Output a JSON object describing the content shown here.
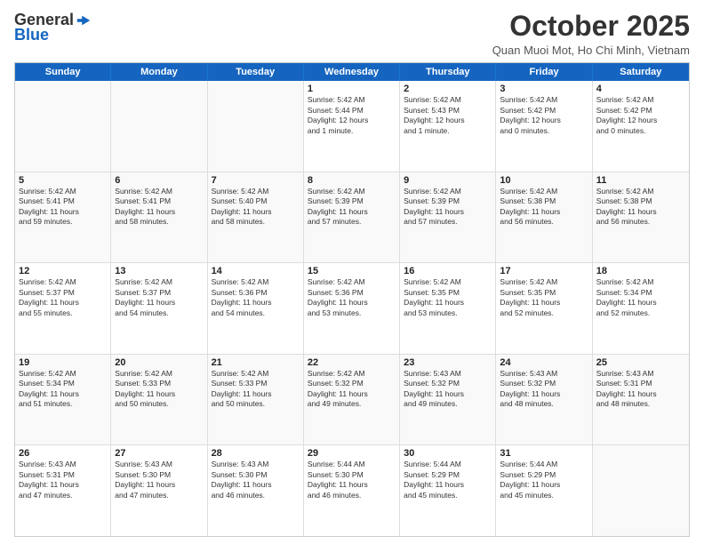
{
  "header": {
    "logo_general": "General",
    "logo_blue": "Blue",
    "title": "October 2025",
    "location": "Quan Muoi Mot, Ho Chi Minh, Vietnam"
  },
  "days_of_week": [
    "Sunday",
    "Monday",
    "Tuesday",
    "Wednesday",
    "Thursday",
    "Friday",
    "Saturday"
  ],
  "rows": [
    [
      {
        "day": "",
        "lines": []
      },
      {
        "day": "",
        "lines": []
      },
      {
        "day": "",
        "lines": []
      },
      {
        "day": "1",
        "lines": [
          "Sunrise: 5:42 AM",
          "Sunset: 5:44 PM",
          "Daylight: 12 hours",
          "and 1 minute."
        ]
      },
      {
        "day": "2",
        "lines": [
          "Sunrise: 5:42 AM",
          "Sunset: 5:43 PM",
          "Daylight: 12 hours",
          "and 1 minute."
        ]
      },
      {
        "day": "3",
        "lines": [
          "Sunrise: 5:42 AM",
          "Sunset: 5:42 PM",
          "Daylight: 12 hours",
          "and 0 minutes."
        ]
      },
      {
        "day": "4",
        "lines": [
          "Sunrise: 5:42 AM",
          "Sunset: 5:42 PM",
          "Daylight: 12 hours",
          "and 0 minutes."
        ]
      }
    ],
    [
      {
        "day": "5",
        "lines": [
          "Sunrise: 5:42 AM",
          "Sunset: 5:41 PM",
          "Daylight: 11 hours",
          "and 59 minutes."
        ]
      },
      {
        "day": "6",
        "lines": [
          "Sunrise: 5:42 AM",
          "Sunset: 5:41 PM",
          "Daylight: 11 hours",
          "and 58 minutes."
        ]
      },
      {
        "day": "7",
        "lines": [
          "Sunrise: 5:42 AM",
          "Sunset: 5:40 PM",
          "Daylight: 11 hours",
          "and 58 minutes."
        ]
      },
      {
        "day": "8",
        "lines": [
          "Sunrise: 5:42 AM",
          "Sunset: 5:39 PM",
          "Daylight: 11 hours",
          "and 57 minutes."
        ]
      },
      {
        "day": "9",
        "lines": [
          "Sunrise: 5:42 AM",
          "Sunset: 5:39 PM",
          "Daylight: 11 hours",
          "and 57 minutes."
        ]
      },
      {
        "day": "10",
        "lines": [
          "Sunrise: 5:42 AM",
          "Sunset: 5:38 PM",
          "Daylight: 11 hours",
          "and 56 minutes."
        ]
      },
      {
        "day": "11",
        "lines": [
          "Sunrise: 5:42 AM",
          "Sunset: 5:38 PM",
          "Daylight: 11 hours",
          "and 56 minutes."
        ]
      }
    ],
    [
      {
        "day": "12",
        "lines": [
          "Sunrise: 5:42 AM",
          "Sunset: 5:37 PM",
          "Daylight: 11 hours",
          "and 55 minutes."
        ]
      },
      {
        "day": "13",
        "lines": [
          "Sunrise: 5:42 AM",
          "Sunset: 5:37 PM",
          "Daylight: 11 hours",
          "and 54 minutes."
        ]
      },
      {
        "day": "14",
        "lines": [
          "Sunrise: 5:42 AM",
          "Sunset: 5:36 PM",
          "Daylight: 11 hours",
          "and 54 minutes."
        ]
      },
      {
        "day": "15",
        "lines": [
          "Sunrise: 5:42 AM",
          "Sunset: 5:36 PM",
          "Daylight: 11 hours",
          "and 53 minutes."
        ]
      },
      {
        "day": "16",
        "lines": [
          "Sunrise: 5:42 AM",
          "Sunset: 5:35 PM",
          "Daylight: 11 hours",
          "and 53 minutes."
        ]
      },
      {
        "day": "17",
        "lines": [
          "Sunrise: 5:42 AM",
          "Sunset: 5:35 PM",
          "Daylight: 11 hours",
          "and 52 minutes."
        ]
      },
      {
        "day": "18",
        "lines": [
          "Sunrise: 5:42 AM",
          "Sunset: 5:34 PM",
          "Daylight: 11 hours",
          "and 52 minutes."
        ]
      }
    ],
    [
      {
        "day": "19",
        "lines": [
          "Sunrise: 5:42 AM",
          "Sunset: 5:34 PM",
          "Daylight: 11 hours",
          "and 51 minutes."
        ]
      },
      {
        "day": "20",
        "lines": [
          "Sunrise: 5:42 AM",
          "Sunset: 5:33 PM",
          "Daylight: 11 hours",
          "and 50 minutes."
        ]
      },
      {
        "day": "21",
        "lines": [
          "Sunrise: 5:42 AM",
          "Sunset: 5:33 PM",
          "Daylight: 11 hours",
          "and 50 minutes."
        ]
      },
      {
        "day": "22",
        "lines": [
          "Sunrise: 5:42 AM",
          "Sunset: 5:32 PM",
          "Daylight: 11 hours",
          "and 49 minutes."
        ]
      },
      {
        "day": "23",
        "lines": [
          "Sunrise: 5:43 AM",
          "Sunset: 5:32 PM",
          "Daylight: 11 hours",
          "and 49 minutes."
        ]
      },
      {
        "day": "24",
        "lines": [
          "Sunrise: 5:43 AM",
          "Sunset: 5:32 PM",
          "Daylight: 11 hours",
          "and 48 minutes."
        ]
      },
      {
        "day": "25",
        "lines": [
          "Sunrise: 5:43 AM",
          "Sunset: 5:31 PM",
          "Daylight: 11 hours",
          "and 48 minutes."
        ]
      }
    ],
    [
      {
        "day": "26",
        "lines": [
          "Sunrise: 5:43 AM",
          "Sunset: 5:31 PM",
          "Daylight: 11 hours",
          "and 47 minutes."
        ]
      },
      {
        "day": "27",
        "lines": [
          "Sunrise: 5:43 AM",
          "Sunset: 5:30 PM",
          "Daylight: 11 hours",
          "and 47 minutes."
        ]
      },
      {
        "day": "28",
        "lines": [
          "Sunrise: 5:43 AM",
          "Sunset: 5:30 PM",
          "Daylight: 11 hours",
          "and 46 minutes."
        ]
      },
      {
        "day": "29",
        "lines": [
          "Sunrise: 5:44 AM",
          "Sunset: 5:30 PM",
          "Daylight: 11 hours",
          "and 46 minutes."
        ]
      },
      {
        "day": "30",
        "lines": [
          "Sunrise: 5:44 AM",
          "Sunset: 5:29 PM",
          "Daylight: 11 hours",
          "and 45 minutes."
        ]
      },
      {
        "day": "31",
        "lines": [
          "Sunrise: 5:44 AM",
          "Sunset: 5:29 PM",
          "Daylight: 11 hours",
          "and 45 minutes."
        ]
      },
      {
        "day": "",
        "lines": []
      }
    ]
  ]
}
